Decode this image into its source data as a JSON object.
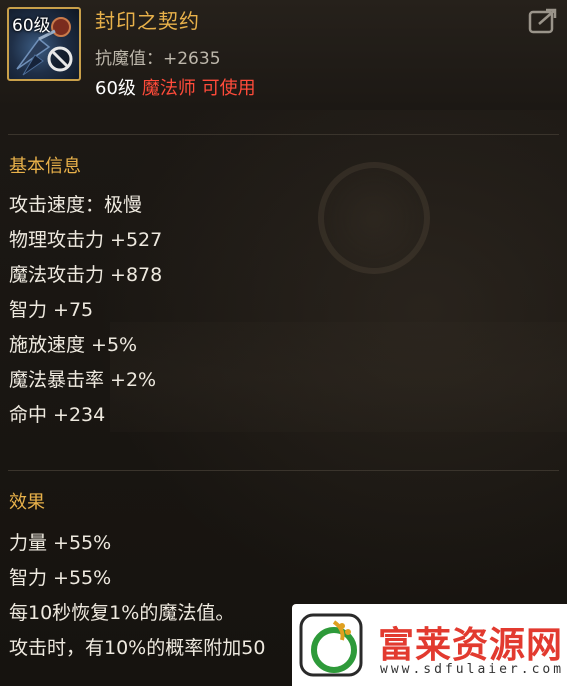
{
  "item": {
    "icon_level": "60级",
    "name": "封印之契约",
    "stat": "抗魔值：+2635",
    "req_level": "60级",
    "req_class": "魔法师 可使用"
  },
  "sections": {
    "basic_title": "基本信息",
    "basic_attrs": [
      "攻击速度：极慢",
      "物理攻击力 +527",
      "魔法攻击力 +878",
      "智力 +75",
      "施放速度 +5%",
      "魔法暴击率 +2%",
      "命中 +234"
    ],
    "effect_title": "效果",
    "effect_attrs": [
      "力量 +55%",
      "智力 +55%",
      "每10秒恢复1%的魔法值。",
      "攻击时，有10%的概率附加50"
    ]
  },
  "watermark": {
    "title": "富莱资源网",
    "url": "www.sdfulaier.com"
  },
  "colors": {
    "accent": "#e8b14a",
    "class_req": "#ff4b3a",
    "background": "#1a1612"
  },
  "icons": [
    "item-weapon-icon",
    "unbindable-icon",
    "share-icon",
    "watermark-logo-icon"
  ]
}
